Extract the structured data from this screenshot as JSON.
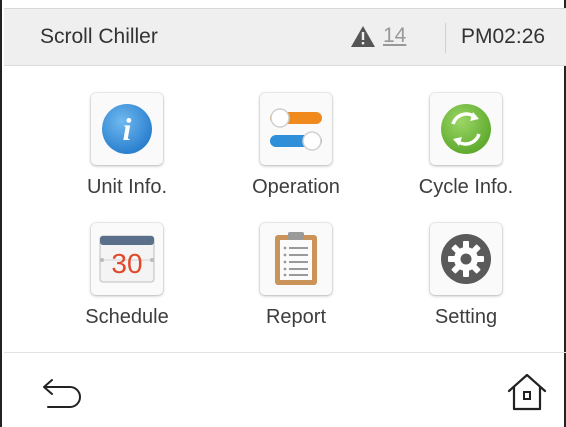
{
  "header": {
    "title": "Scroll Chiller",
    "alarm_icon": "warning-triangle-icon",
    "alarm_count": "14",
    "clock": "PM02:26"
  },
  "menu": [
    {
      "label": "Unit Info.",
      "icon": "info-icon"
    },
    {
      "label": "Operation",
      "icon": "toggle-switches-icon"
    },
    {
      "label": "Cycle Info.",
      "icon": "cycle-arrows-icon"
    },
    {
      "label": "Schedule",
      "icon": "calendar-icon"
    },
    {
      "label": "Report",
      "icon": "clipboard-icon"
    },
    {
      "label": "Setting",
      "icon": "gear-icon"
    }
  ],
  "calendar_day": "30",
  "footer": {
    "back_icon": "back-arrow-icon",
    "home_icon": "home-icon"
  },
  "colors": {
    "info_blue": "#3a8fd8",
    "operation_orange": "#f08a1c",
    "operation_blue": "#2f8fd8",
    "cycle_green": "#7cc242",
    "calendar_red": "#e04a2a",
    "gear_gray": "#5a5a5a",
    "clipboard_brown": "#c9935a"
  }
}
